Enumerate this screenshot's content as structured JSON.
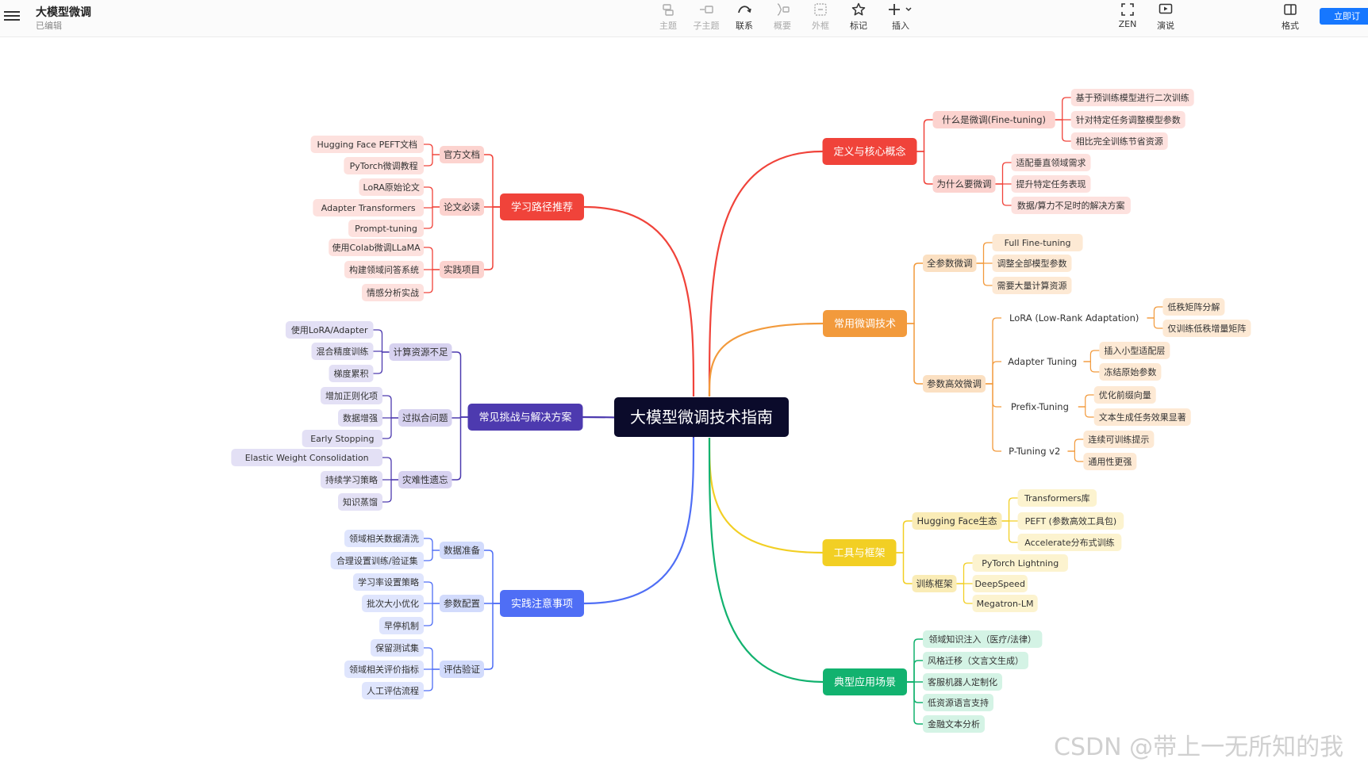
{
  "app": {
    "title": "大模型微调",
    "status": "已编辑"
  },
  "toolbar": [
    {
      "id": "topic",
      "label": "主题",
      "icon": "topic-icon",
      "disabled": true
    },
    {
      "id": "subtopic",
      "label": "子主题",
      "icon": "subtopic-icon",
      "disabled": true
    },
    {
      "id": "relation",
      "label": "联系",
      "icon": "relation-icon",
      "disabled": false
    },
    {
      "id": "summary",
      "label": "概要",
      "icon": "summary-icon",
      "disabled": true
    },
    {
      "id": "boundary",
      "label": "外框",
      "icon": "boundary-icon",
      "disabled": true
    },
    {
      "id": "marker",
      "label": "标记",
      "icon": "star-icon",
      "disabled": false
    },
    {
      "id": "insert",
      "label": "插入",
      "icon": "plus-icon",
      "disabled": false
    },
    {
      "id": "zen",
      "label": "ZEN",
      "icon": "fullscreen-icon",
      "disabled": false
    },
    {
      "id": "pitch",
      "label": "演说",
      "icon": "play-icon",
      "disabled": false
    },
    {
      "id": "format",
      "label": "格式",
      "icon": "format-panel-icon",
      "disabled": false
    }
  ],
  "signup_label": "立即订",
  "watermark": "CSDN @带上一无所知的我",
  "mindmap": {
    "root": "大模型微调技术指南",
    "branches": [
      {
        "name": "定义与核心概念",
        "color": "#f0433a",
        "children": [
          {
            "name": "什么是微调(Fine-tuning)",
            "children": [
              "基于预训练模型进行二次训练",
              "针对特定任务调整模型参数",
              "相比完全训练节省资源"
            ]
          },
          {
            "name": "为什么要微调",
            "children": [
              "适配垂直领域需求",
              "提升特定任务表现",
              "数据/算力不足时的解决方案"
            ]
          }
        ]
      },
      {
        "name": "常用微调技术",
        "color": "#f29a3c",
        "children": [
          {
            "name": "全参数微调",
            "children": [
              "Full Fine-tuning",
              "调整全部模型参数",
              "需要大量计算资源"
            ]
          },
          {
            "name": "参数高效微调",
            "children": [
              {
                "name": "LoRA (Low-Rank Adaptation)",
                "children": [
                  "低秩矩阵分解",
                  "仅训练低秩增量矩阵"
                ]
              },
              {
                "name": "Adapter Tuning",
                "children": [
                  "插入小型适配层",
                  "冻结原始参数"
                ]
              },
              {
                "name": "Prefix-Tuning",
                "children": [
                  "优化前缀向量",
                  "文本生成任务效果显著"
                ]
              },
              {
                "name": "P-Tuning v2",
                "children": [
                  "连续可训练提示",
                  "通用性更强"
                ]
              }
            ]
          }
        ]
      },
      {
        "name": "工具与框架",
        "color": "#f2cf24",
        "children": [
          {
            "name": "Hugging Face生态",
            "children": [
              "Transformers库",
              "PEFT (参数高效工具包)",
              "Accelerate分布式训练"
            ]
          },
          {
            "name": "训练框架",
            "children": [
              "PyTorch Lightning",
              "DeepSpeed",
              "Megatron-LM"
            ]
          }
        ]
      },
      {
        "name": "典型应用场景",
        "color": "#12b26f",
        "children": [
          "领域知识注入（医疗/法律）",
          "风格迁移（文言文生成）",
          "客服机器人定制化",
          "低资源语言支持",
          "金融文本分析"
        ]
      },
      {
        "name": "学习路径推荐",
        "color": "#f0433a",
        "children": [
          {
            "name": "官方文档",
            "children": [
              "Hugging Face PEFT文档",
              "PyTorch微调教程"
            ]
          },
          {
            "name": "论文必读",
            "children": [
              "LoRA原始论文",
              "Adapter Transformers",
              "Prompt-tuning"
            ]
          },
          {
            "name": "实践项目",
            "children": [
              "使用Colab微调LLaMA",
              "构建领域问答系统",
              "情感分析实战"
            ]
          }
        ]
      },
      {
        "name": "常见挑战与解决方案",
        "color": "#4d3aaf",
        "children": [
          {
            "name": "计算资源不足",
            "children": [
              "使用LoRA/Adapter",
              "混合精度训练",
              "梯度累积"
            ]
          },
          {
            "name": "过拟合问题",
            "children": [
              "增加正则化项",
              "数据增强",
              "Early Stopping"
            ]
          },
          {
            "name": "灾难性遗忘",
            "children": [
              "Elastic Weight Consolidation",
              "持续学习策略",
              "知识蒸馏"
            ]
          }
        ]
      },
      {
        "name": "实践注意事项",
        "color": "#4f6ef5",
        "children": [
          {
            "name": "数据准备",
            "children": [
              "领域相关数据清洗",
              "合理设置训练/验证集"
            ]
          },
          {
            "name": "参数配置",
            "children": [
              "学习率设置策略",
              "批次大小优化",
              "早停机制"
            ]
          },
          {
            "name": "评估验证",
            "children": [
              "保留测试集",
              "领域相关评价指标",
              "人工评估流程"
            ]
          }
        ]
      }
    ]
  }
}
